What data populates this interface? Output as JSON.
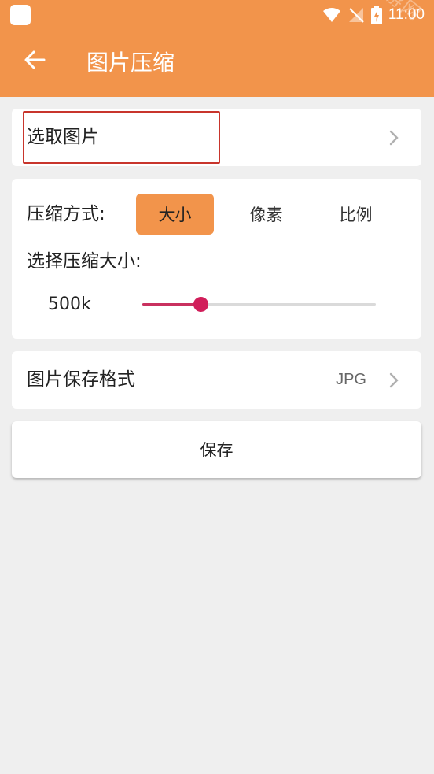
{
  "status_bar": {
    "time": "11:00"
  },
  "app_bar": {
    "title": "图片压缩",
    "watermark": "嗨游手游网"
  },
  "select_image": {
    "label": "选取图片"
  },
  "compress": {
    "mode_label": "压缩方式:",
    "modes": [
      "大小",
      "像素",
      "比例"
    ],
    "active_mode": "大小",
    "size_label": "选择压缩大小:",
    "size_value": "500k",
    "slider_fraction": 0.25
  },
  "save_format": {
    "label": "图片保存格式",
    "value": "JPG"
  },
  "save_button": {
    "label": "保存"
  },
  "colors": {
    "accent": "#f2944b",
    "slider": "#d11e5a",
    "highlight": "#c8352c"
  }
}
